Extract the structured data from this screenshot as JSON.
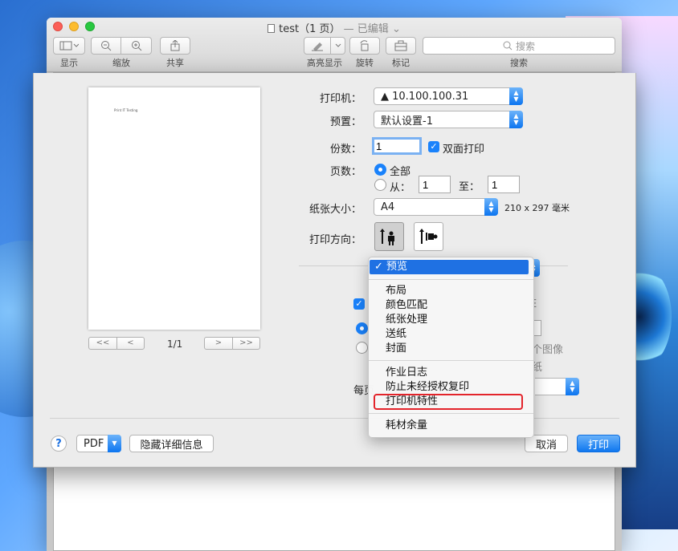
{
  "window": {
    "title": "test（1 页）",
    "edited_status": "— 已编辑",
    "toolbar": {
      "view_label": "显示",
      "zoom_label": "缩放",
      "share_label": "共享",
      "highlight_label": "高亮显示",
      "rotate_label": "旋转",
      "markup_label": "标记",
      "search_placeholder": "搜索",
      "search_label": "搜索"
    }
  },
  "preview": {
    "thumb_text": "Print IT Testing",
    "page_indicator": "1/1",
    "prev_buttons": [
      "<<",
      "<"
    ],
    "next_buttons": [
      ">",
      ">>"
    ]
  },
  "print": {
    "printer_label": "打印机：",
    "printer_value": "▲ 10.100.100.31",
    "presets_label": "预置：",
    "presets_value": "默认设置-1",
    "copies_label": "份数：",
    "copies_value": "1",
    "duplex_label": "双面打印",
    "pages_label": "页数：",
    "pages_all": "全部",
    "pages_from": "从：",
    "pages_from_value": "1",
    "pages_to": "至：",
    "pages_to_value": "1",
    "paper_size_label": "纸张大小：",
    "paper_size_value": "A4",
    "paper_size_dims": "210 x 297 毫米",
    "orientation_label": "打印方向：",
    "per_page_partial": "每页",
    "ghost_right_1": "E",
    "ghost_right_2": "个图像",
    "ghost_right_3": "纸"
  },
  "menu": {
    "selected": "预览",
    "group1": [
      "布局",
      "颜色匹配",
      "纸张处理",
      "送纸",
      "封面"
    ],
    "group2": [
      "作业日志",
      "防止未经授权复印",
      "打印机特性"
    ],
    "group3": [
      "耗材余量"
    ]
  },
  "footer": {
    "help": "?",
    "pdf": "PDF",
    "hide_details": "隐藏详细信息",
    "cancel": "取消",
    "print": "打印"
  }
}
